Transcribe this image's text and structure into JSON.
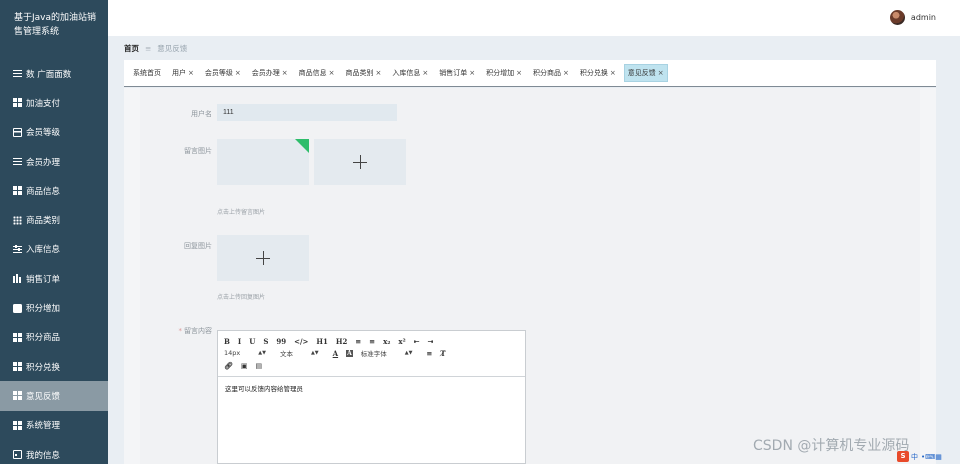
{
  "sidebar": {
    "brand": "基于Java的加油站销售管理系统",
    "items": [
      {
        "label": "数 广面面数",
        "icon": "lines-icon",
        "active": false
      },
      {
        "label": "加油支付",
        "icon": "grid-icon",
        "active": false
      },
      {
        "label": "会员等级",
        "icon": "card-icon",
        "active": false
      },
      {
        "label": "会员办理",
        "icon": "lines-icon",
        "active": false
      },
      {
        "label": "商品信息",
        "icon": "grid-icon",
        "active": false
      },
      {
        "label": "商品类别",
        "icon": "dots-grid-icon",
        "active": false
      },
      {
        "label": "入库信息",
        "icon": "sliders-icon",
        "active": false
      },
      {
        "label": "销售订单",
        "icon": "bar-chart-icon",
        "active": false
      },
      {
        "label": "积分增加",
        "icon": "chat-icon",
        "active": false
      },
      {
        "label": "积分商品",
        "icon": "grid-icon",
        "active": false
      },
      {
        "label": "积分兑换",
        "icon": "grid-icon",
        "active": false
      },
      {
        "label": "意见反馈",
        "icon": "grid-icon",
        "active": true
      },
      {
        "label": "系统管理",
        "icon": "grid-icon",
        "active": false
      },
      {
        "label": "我的信息",
        "icon": "id-card-icon",
        "active": false
      }
    ]
  },
  "header": {
    "username": "admin"
  },
  "breadcrumb": {
    "home": "首页",
    "separator": "≡",
    "current": "意见反馈"
  },
  "tabs": [
    {
      "label": "系统首页",
      "closable": false,
      "active": false
    },
    {
      "label": "用户",
      "closable": true,
      "active": false
    },
    {
      "label": "会员等级",
      "closable": true,
      "active": false
    },
    {
      "label": "会员办理",
      "closable": true,
      "active": false
    },
    {
      "label": "商品信息",
      "closable": true,
      "active": false
    },
    {
      "label": "商品类别",
      "closable": true,
      "active": false
    },
    {
      "label": "入库信息",
      "closable": true,
      "active": false
    },
    {
      "label": "销售订单",
      "closable": true,
      "active": false
    },
    {
      "label": "积分增加",
      "closable": true,
      "active": false
    },
    {
      "label": "积分商品",
      "closable": true,
      "active": false
    },
    {
      "label": "积分兑换",
      "closable": true,
      "active": false
    },
    {
      "label": "意见反馈",
      "closable": true,
      "active": true
    }
  ],
  "form": {
    "username_label": "用户名",
    "username_value": "111",
    "message_image_label": "留言图片",
    "message_image_hint": "点击上传留言图片",
    "reply_image_label": "回复图片",
    "reply_image_hint": "点击上传回复图片",
    "content_label": "留言内容",
    "content_required_mark": "*",
    "content_value": "这里可以反馈内容给管理员"
  },
  "editor_toolbar": {
    "row1": [
      "B",
      "I",
      "U",
      "S",
      "99",
      "</>",
      "H1",
      "H2",
      "≡",
      "≡",
      "x₂",
      "x²",
      "⇤",
      "⇥"
    ],
    "font_size": "14px",
    "paragraph": "文本",
    "color": "A",
    "font_family": "标准字体",
    "row3": [
      "link",
      "image",
      "video"
    ]
  },
  "watermark": "CSDN @计算机专业源码",
  "ime": {
    "logo": "S",
    "lang": "中"
  },
  "colors": {
    "sidebar": "#2d4a5c",
    "active_tab": "#bfe3ef",
    "corner_badge": "#2ebd6b"
  }
}
